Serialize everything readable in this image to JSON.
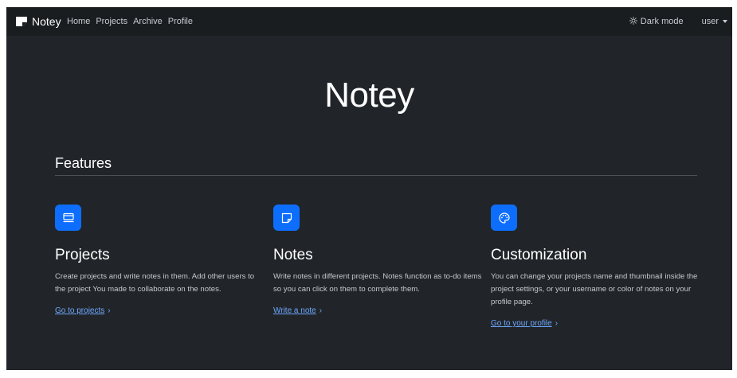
{
  "navbar": {
    "brand": "Notey",
    "links": [
      "Home",
      "Projects",
      "Archive",
      "Profile"
    ],
    "theme_toggle": "Dark mode",
    "user": "user"
  },
  "hero": {
    "title": "Notey"
  },
  "features": {
    "heading": "Features",
    "items": [
      {
        "icon": "window-icon",
        "title": "Projects",
        "description": "Create projects and write notes in them. Add other users to the project You made to collaborate on the notes.",
        "link": "Go to projects",
        "chevron": "›"
      },
      {
        "icon": "sticky-note-icon",
        "title": "Notes",
        "description": "Write notes in different projects. Notes function as to-do items so you can click on them to complete them.",
        "link": "Write a note",
        "chevron": "›"
      },
      {
        "icon": "palette-icon",
        "title": "Customization",
        "description": "You can change your projects name and thumbnail inside the project settings, or your username or color of notes on your profile page.",
        "link": "Go to your profile",
        "chevron": "›"
      }
    ]
  },
  "colors": {
    "background": "#212529",
    "navbar": "#1a1d20",
    "accent": "#0d6efd",
    "link": "#6ea8fe"
  }
}
